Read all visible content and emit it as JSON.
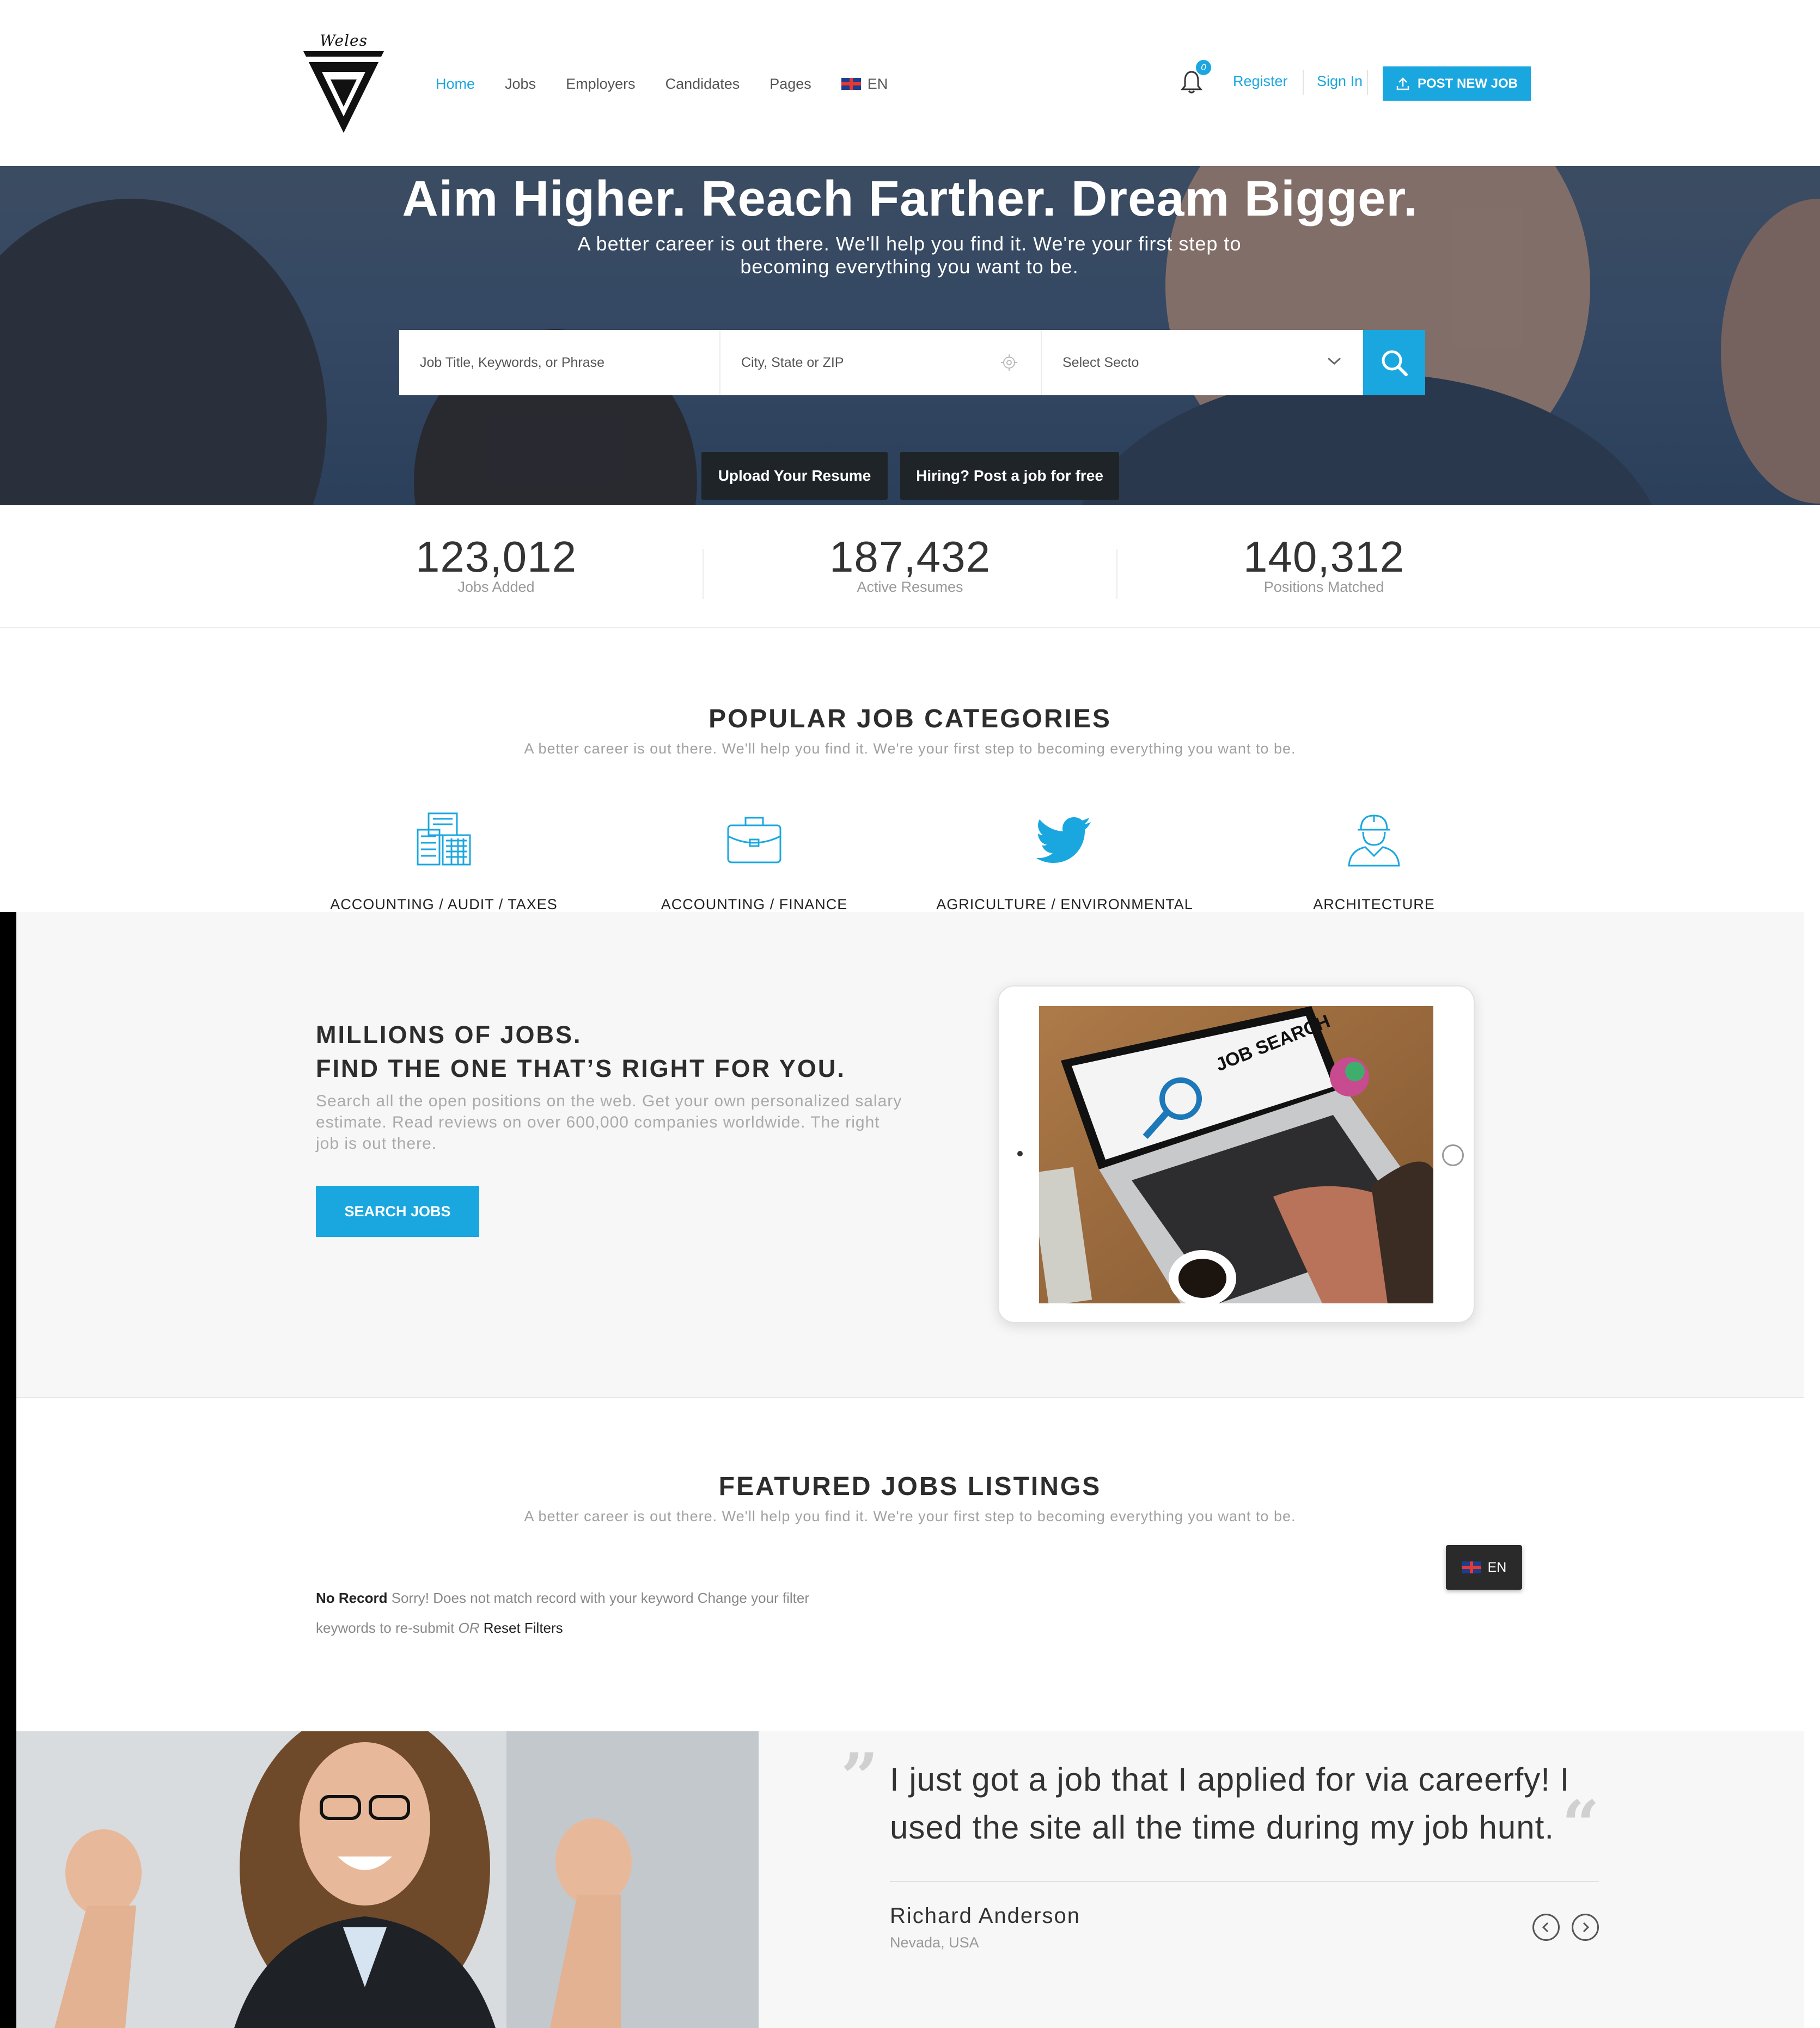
{
  "header": {
    "logo_text": "Weles",
    "nav": [
      "Home",
      "Jobs",
      "Employers",
      "Candidates",
      "Pages"
    ],
    "lang": "EN",
    "notification_count": "0",
    "register": "Register",
    "sign_in": "Sign In",
    "post_job": "POST NEW JOB"
  },
  "hero": {
    "title": "Aim Higher. Reach Farther. Dream Bigger.",
    "subtitle": "A better career is out there. We'll help you find it. We're your first step to becoming everything you want to be.",
    "search": {
      "keyword_placeholder": "Job Title, Keywords, or Phrase",
      "location_placeholder": "City, State or ZIP",
      "sector": "Select Secto"
    },
    "upload_resume": "Upload Your Resume",
    "post_free": "Hiring? Post a job for free"
  },
  "stats": [
    {
      "value": "123,012",
      "label": "Jobs Added"
    },
    {
      "value": "187,432",
      "label": "Active Resumes"
    },
    {
      "value": "140,312",
      "label": "Positions Matched"
    }
  ],
  "categories": {
    "title": "POPULAR JOB CATEGORIES",
    "subtitle": "A better career is out there. We'll help you find it. We're your first step to becoming everything you want to be.",
    "items": [
      {
        "label": "ACCOUNTING / AUDIT / TAXES",
        "icon": "ledger-icon"
      },
      {
        "label": "ACCOUNTING / FINANCE",
        "icon": "briefcase-icon"
      },
      {
        "label": "AGRICULTURE / ENVIRONMENTAL",
        "icon": "twitter-bird-icon"
      },
      {
        "label": "ARCHITECTURE",
        "icon": "worker-icon"
      }
    ]
  },
  "millions": {
    "title_line1": "MILLIONS OF JOBS.",
    "title_line2": "FIND THE ONE THAT’S RIGHT FOR YOU.",
    "text": "Search all the open positions on the web. Get your own personalized salary estimate. Read reviews on over 600,000 companies worldwide. The right job is out there.",
    "button": "SEARCH JOBS",
    "screen_text": "JOB SEARCH"
  },
  "featured": {
    "title": "FEATURED JOBS LISTINGS",
    "subtitle": "A better career is out there. We'll help you find it. We're your first step to becoming everything you want to be.",
    "no_record_bold": "No Record",
    "no_record_text": " Sorry!  Does not match record with your keyword Change your filter",
    "no_record_text2": "keywords to re-submit ",
    "or": "OR",
    "reset": " Reset Filters",
    "lang_popup": "EN"
  },
  "testimonial": {
    "quote": "I just got a job that I applied for via careerfy! I used the site all the time during my job hunt.",
    "name": "Richard Anderson",
    "location": "Nevada, USA"
  },
  "colors": {
    "accent": "#1aa7e0",
    "dark_button": "#1f2428"
  }
}
